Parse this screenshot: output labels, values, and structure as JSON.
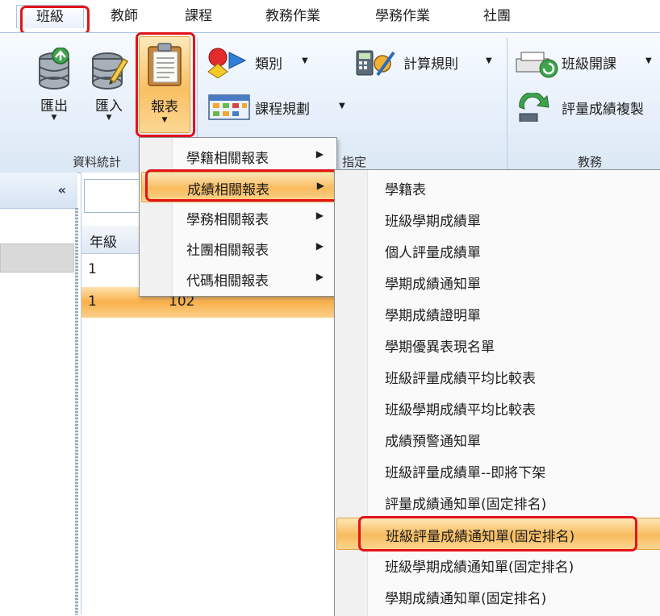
{
  "tabs": [
    "班級",
    "教師",
    "課程",
    "教務作業",
    "學務作業",
    "社團"
  ],
  "ribbon": {
    "group_data_label": "資料統計",
    "group_assign_label": "指定",
    "group_academic_label": "教務",
    "export_label": "匯出",
    "import_label": "匯入",
    "report_label": "報表",
    "category_label": "類別",
    "course_plan_label": "課程規劃",
    "calc_rule_label": "計算規則",
    "class_course_label": "班級開課",
    "score_copy_label": "評量成績複製"
  },
  "left_panel": {
    "collapse_glyph": "«"
  },
  "grid": {
    "column_grade": "年級",
    "rows": [
      {
        "grade": "1",
        "name": ""
      },
      {
        "grade": "1",
        "name": "102"
      }
    ]
  },
  "report_menu": {
    "items": [
      "學籍相關報表",
      "成績相關報表",
      "學務相關報表",
      "社團相關報表",
      "代碼相關報表"
    ],
    "highlighted_index": 1
  },
  "score_submenu": {
    "items": [
      "學籍表",
      "班級學期成績單",
      "個人評量成績單",
      "學期成績通知單",
      "學期成績證明單",
      "學期優異表現名單",
      "班級評量成績平均比較表",
      "班級學期成績平均比較表",
      "成績預警通知單",
      "班級評量成績單--即將下架",
      "評量成績通知單(固定排名)",
      "班級評量成績通知單(固定排名)",
      "班級學期成績通知單(固定排名)",
      "學期成績通知單(固定排名)"
    ],
    "highlighted_index": 11
  },
  "colors": {
    "annotation_red": "#e2141b",
    "highlight_orange": "#f8bb5e",
    "ribbon_blue": "#dbe7f5"
  }
}
